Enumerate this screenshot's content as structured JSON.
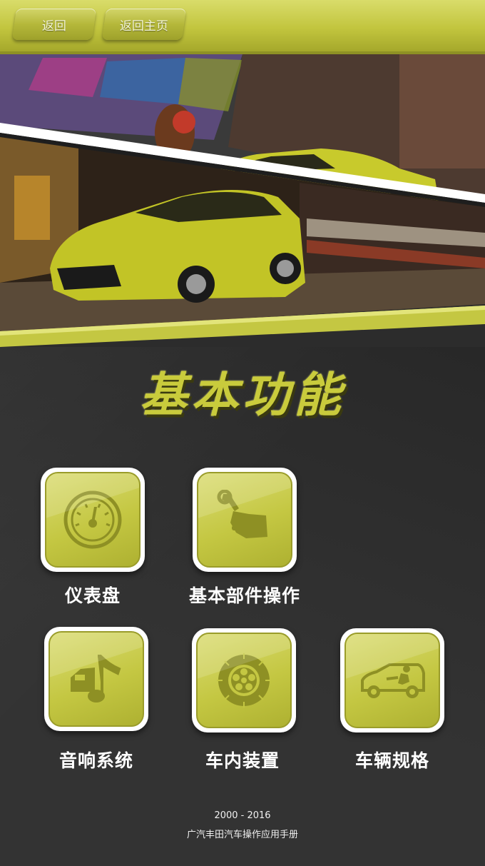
{
  "nav": {
    "back_label": "返回",
    "home_label": "返回主页"
  },
  "section": {
    "title": "基本功能"
  },
  "menu": [
    {
      "label": "仪表盘",
      "icon": "speedometer-icon"
    },
    {
      "label": "基本部件操作",
      "icon": "wrench-hand-icon"
    },
    {
      "label": "音响系统",
      "icon": "music-car-icon"
    },
    {
      "label": "车内装置",
      "icon": "wheel-icon"
    },
    {
      "label": "车辆规格",
      "icon": "car-seat-icon"
    }
  ],
  "footer": {
    "years": "2000 - 2016",
    "caption": "广汽丰田汽车操作应用手册"
  },
  "colors": {
    "accent": "#c4c742",
    "accent_dark": "#9a9c2a",
    "background": "#2c2c2c"
  }
}
